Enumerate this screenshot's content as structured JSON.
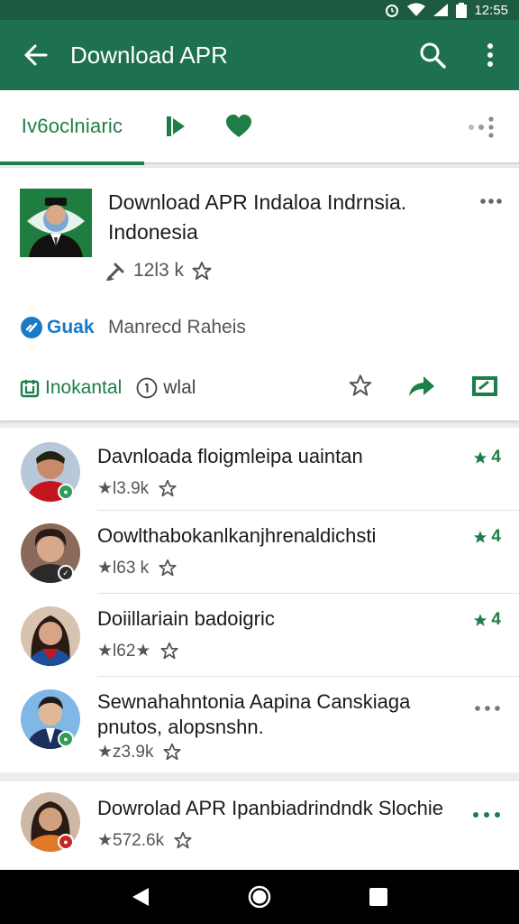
{
  "status_bar": {
    "time": "12:55"
  },
  "app_bar": {
    "title": "Download APR"
  },
  "tabs": {
    "first_label": "Iv6oclniaric"
  },
  "featured": {
    "title": "Download APR Indaloa Indrnsia. Indonesia",
    "meta_count": "12l3 k",
    "dev_brand": "Guak",
    "dev_name": "Manrecd Raheis",
    "label_primary": "Inokantal",
    "label_secondary": "wlal"
  },
  "list_items": [
    {
      "title": "Davnloada floigmleipa uaintan",
      "meta": "★l3.9k",
      "rating": "4"
    },
    {
      "title": "Oowlthabokanlkanjhrenaldichsti",
      "meta": "★l63 k",
      "rating": "4"
    },
    {
      "title": "Doiillariain badoigric",
      "meta": "★l62★",
      "rating": "4"
    },
    {
      "title": "Sewnahahntonia Aapina Canskiaga pnutos, alopsnshn.",
      "meta": "★z3.9k",
      "rating": ""
    },
    {
      "title": "Dowrolad APR Ipanbiadrindndk Slochie",
      "meta": "★572.6k",
      "rating": ""
    }
  ],
  "colors": {
    "primary": "#1e7150",
    "status": "#1c5b3f",
    "accent_green": "#1e7e48",
    "brand_blue": "#1a7ac6"
  }
}
